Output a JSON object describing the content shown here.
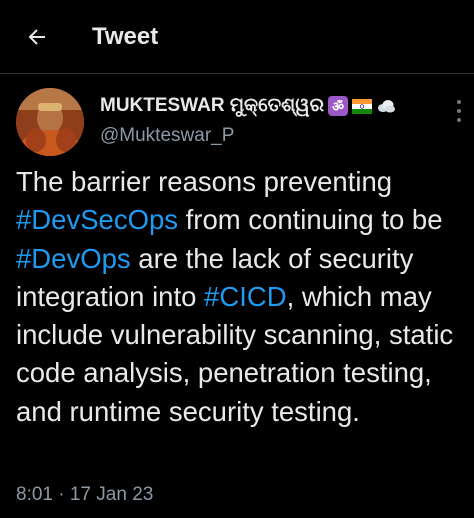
{
  "header": {
    "title": "Tweet",
    "back_icon": "arrow-left-icon"
  },
  "tweet": {
    "author": {
      "display_name": "MUKTESWAR ମୁକ୍ତେଶ୍ୱର",
      "handle": "@Mukteswar_P",
      "name_emojis": [
        "om-icon",
        "india-flag-icon",
        "cloud-icon"
      ]
    },
    "text_segments": [
      {
        "text": "The barrier reasons preventing ",
        "hashtag": false
      },
      {
        "text": "#DevSecOps",
        "hashtag": true
      },
      {
        "text": " from continuing to be ",
        "hashtag": false
      },
      {
        "text": "#DevOps",
        "hashtag": true
      },
      {
        "text": " are the lack of security integration into ",
        "hashtag": false
      },
      {
        "text": "#CICD",
        "hashtag": true
      },
      {
        "text": ", which may include vulnerability scanning, static code analysis, penetration testing, and runtime security testing.",
        "hashtag": false
      }
    ],
    "timestamp": "8:01 · 17 Jan 23"
  },
  "colors": {
    "background": "#000000",
    "text": "#e7e9ea",
    "secondary": "#8b98a5",
    "accent": "#1d9bf0",
    "divider": "#2f3336"
  }
}
